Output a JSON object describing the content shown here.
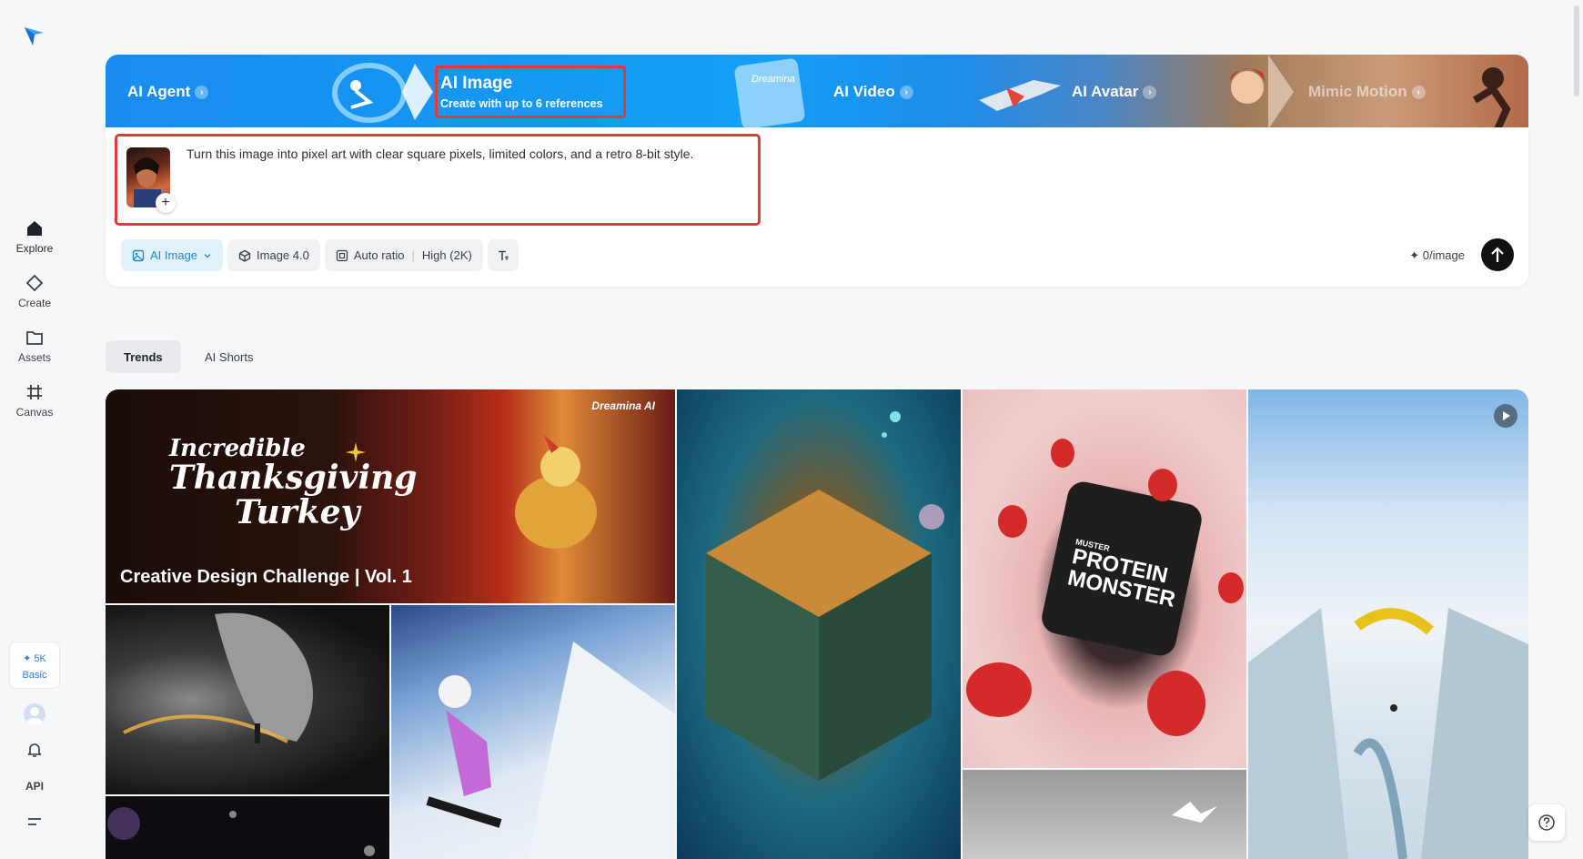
{
  "sidebar": {
    "items": [
      {
        "label": "Explore",
        "icon": "home-icon"
      },
      {
        "label": "Create",
        "icon": "diamond-icon"
      },
      {
        "label": "Assets",
        "icon": "folder-icon"
      },
      {
        "label": "Canvas",
        "icon": "hash-icon"
      }
    ],
    "credits": {
      "amount": "✦ 5K",
      "plan": "Basic"
    },
    "api_label": "API"
  },
  "banner": {
    "tabs": [
      {
        "label": "AI Agent"
      },
      {
        "label": "AI Video"
      },
      {
        "label": "AI Avatar"
      },
      {
        "label": "Mimic Motion"
      }
    ],
    "active_tab": {
      "label": "AI Image",
      "subtitle": "Create with up to 6 references"
    },
    "deco_label": "Dreamina"
  },
  "prompt": {
    "text": "Turn this image into pixel art with clear square pixels, limited colors, and a retro 8-bit style.",
    "add_label": "+"
  },
  "toolbar": {
    "mode": "AI Image",
    "model": "Image 4.0",
    "ratio": "Auto ratio",
    "quality": "High (2K)",
    "cost": "✦ 0/image"
  },
  "filters": {
    "tabs": [
      "Trends",
      "AI Shorts"
    ],
    "selected": "Trends"
  },
  "gallery": {
    "feature": {
      "headline1": "Incredible",
      "headline2": "Thanksgiving",
      "headline3": "Turkey",
      "caption": "Creative Design Challenge | Vol. 1",
      "brand": "Dreamina AI"
    },
    "product_label": "PROTEIN MONSTER",
    "product_brand": "MUSTER"
  },
  "colors": {
    "accent": "#1e8ad6",
    "highlight": "#e53935",
    "send": "#111111"
  }
}
